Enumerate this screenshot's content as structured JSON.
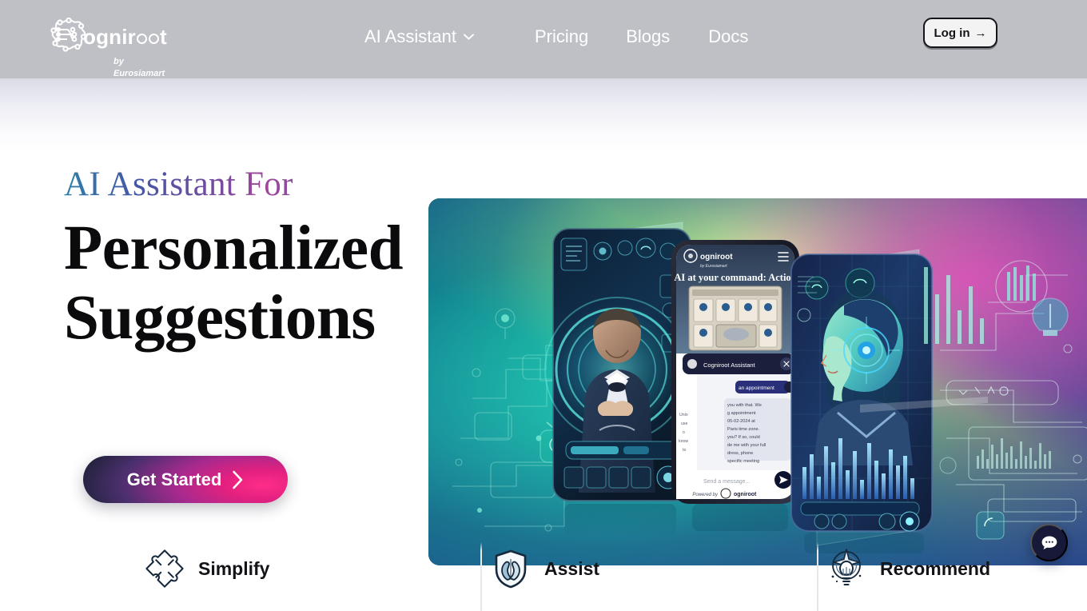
{
  "header": {
    "brand": {
      "word": "ognir",
      "word_tail": "t",
      "sub_line1": "by",
      "sub_line2": "Eurosiamart",
      "logo_icon": "cogniroot-brain-gear-icon"
    },
    "nav": [
      {
        "label": "AI Assistant",
        "has_chevron": true,
        "icon": "chevron-down-icon"
      },
      {
        "label": "Pricing",
        "has_chevron": false
      },
      {
        "label": "Blogs",
        "has_chevron": false
      },
      {
        "label": "Docs",
        "has_chevron": false
      }
    ],
    "login": {
      "label": "Log in",
      "arrow": "→"
    },
    "background_color": "#bfc0c6"
  },
  "hero": {
    "eyebrow": "AI Assistant For",
    "headline_line1": "Personalized",
    "headline_line2": "Suggestions",
    "cta_label": "Get Started",
    "cta_icon": "chevron-right-icon",
    "accent_gradient_start": "#2f7fa8",
    "accent_gradient_mid": "#a2479a",
    "accent_gradient_end": "#2f5f9e",
    "cta_accent": "#ff2d8a",
    "cta_base": "#1d2137",
    "art": {
      "alt": "ai-assistant-devices-illustration",
      "phone_title": "AI at your command: Action",
      "chat_header": "Cogniroot Assistant",
      "chat_input_placeholder": "Send a message...",
      "chat_footer": "Powered by Cogniroot",
      "chat_bubble_user": "an appointment",
      "chat_bubble_bot": "you with that. We g appointment 05-02-2024 at Paris time zone. you? If so, could de me with your full dress, phone specific meeting"
    }
  },
  "features": [
    {
      "label": "Simplify",
      "icon": "puzzle-pieces-icon"
    },
    {
      "label": "Assist",
      "icon": "shield-hands-icon"
    },
    {
      "label": "Recommend",
      "icon": "lightbulb-compass-icon"
    }
  ],
  "chat_widget": {
    "icon": "chat-bubble-icon",
    "color": "#161a38"
  }
}
